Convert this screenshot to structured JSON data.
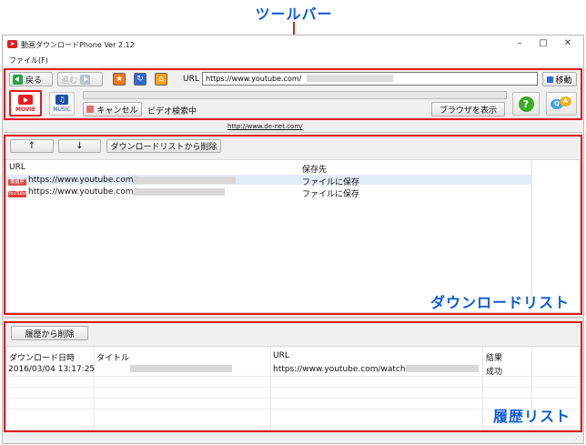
{
  "callouts": {
    "toolbar": "ツールバー",
    "download_list": "ダウンロードリスト",
    "history_list": "履歴リスト"
  },
  "window": {
    "title": "動画ダウンロードPhone Ver 2.12",
    "minimize": "–",
    "maximize": "□",
    "close": "✕"
  },
  "menu": {
    "file": "ファイル(F)"
  },
  "toolbar": {
    "back_label": "戻る",
    "forward_label": "進む",
    "url_label": "URL",
    "url_value": "https://www.youtube.com/",
    "go_label": "移動",
    "movie_label": "MOVIE",
    "music_label": "MUSIC",
    "music_glyph": "♫",
    "cancel_label": "キャンセル",
    "status": "ビデオ検索中",
    "show_browser_label": "ブラウザを表示",
    "help_glyph": "?",
    "q_glyph": "Q",
    "a_glyph": "A",
    "fav_glyph": "★",
    "reload_glyph": "↻",
    "home_glyph": "⌂",
    "progress_fraction": 0
  },
  "site_link": "http://www.de-net.com/",
  "download_list": {
    "up_label": "↑",
    "down_label": "↓",
    "delete_label": "ダウンロードリストから削除",
    "columns": [
      "URL",
      "保存先"
    ],
    "rows": [
      {
        "tag": "動画中",
        "url": "https://www.youtube.com/",
        "dest": "ファイルに保存"
      },
      {
        "tag": "YouTube",
        "url": "https://www.youtube.com/",
        "dest": "ファイルに保存"
      }
    ]
  },
  "history": {
    "delete_label": "履歴から削除",
    "columns": [
      "ダウンロード日時",
      "タイトル",
      "URL",
      "結果"
    ],
    "rows": [
      {
        "date": "2016/03/04 13:17:25",
        "url": "https://www.youtube.com/watch?",
        "result": "成功"
      }
    ]
  },
  "colors": {
    "accent_red": "#e21c1c",
    "callout_blue": "#0c5ad6",
    "selection": "#e1ecf9"
  }
}
